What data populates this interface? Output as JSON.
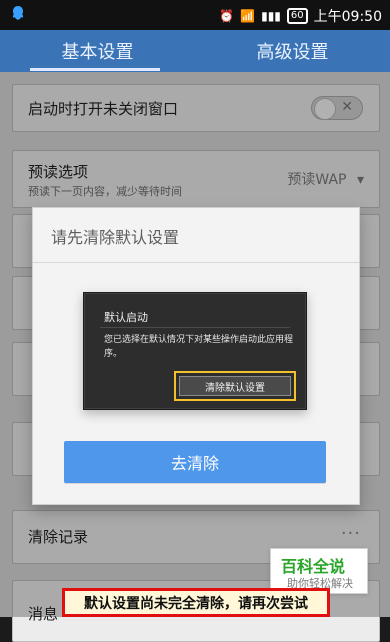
{
  "status_bar": {
    "time": "上午09:50",
    "battery_badge": "60",
    "icons": [
      "qq-icon",
      "alarm-icon",
      "wifi-icon",
      "signal-icon",
      "battery-icon"
    ]
  },
  "tabs": [
    {
      "label": "基本设置",
      "active": true
    },
    {
      "label": "高级设置",
      "active": false
    }
  ],
  "settings": {
    "open_unclosed": {
      "title": "启动时打开未关闭窗口",
      "toggle": false
    },
    "preload": {
      "title": "预读选项",
      "subtitle": "预读下一页内容，减少等待时间",
      "value": "预读WAP"
    },
    "clear_records": {
      "title": "清除记录"
    },
    "message_partial": {
      "title": "消息"
    }
  },
  "dialog": {
    "title": "请先清除默认设置",
    "inner": {
      "title": "默认启动",
      "text": "您已选择在默认情况下对某些操作启动此应用程序。",
      "button": "清除默认设置"
    },
    "primary_button": "去清除"
  },
  "annotation": {
    "banner": "默认设置尚未完全清除，请再次尝试",
    "watermark_title": "百科全说",
    "watermark_sub": "助你轻松解决"
  },
  "colors": {
    "tab_bar": "#3b74b6",
    "primary_button": "#4f97ea",
    "highlight_border": "#f2c12b",
    "banner_border": "#e10f0f"
  }
}
